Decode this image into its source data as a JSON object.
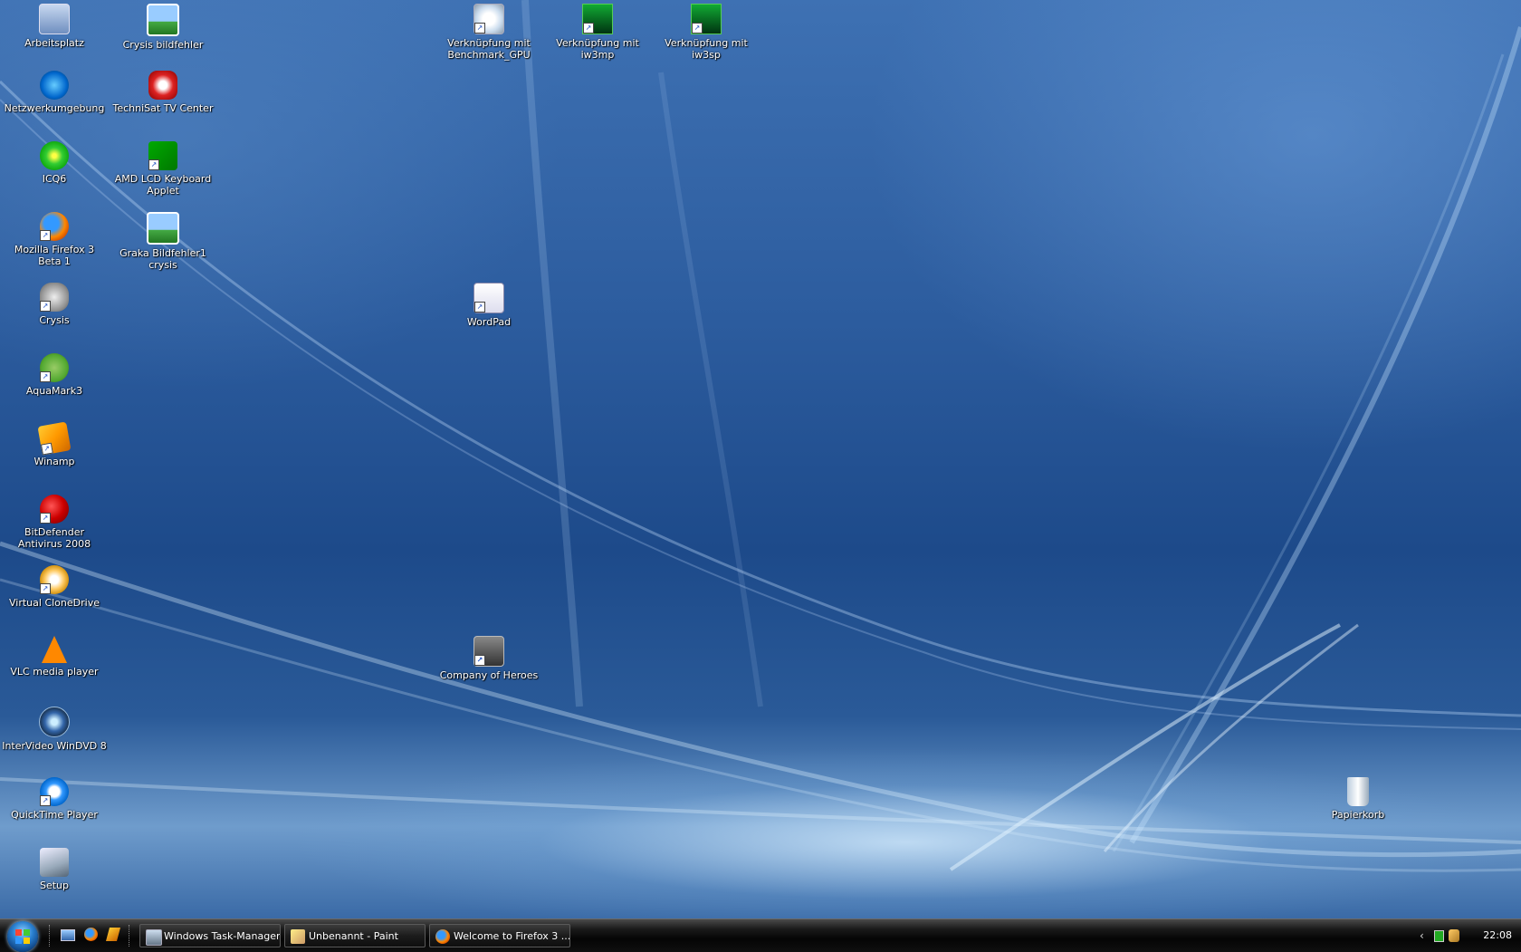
{
  "desktop": {
    "icons": [
      {
        "label": "Arbeitsplatz",
        "icon": "my-computer-icon"
      },
      {
        "label": "Crysis bildfehler",
        "icon": "image-file-icon"
      },
      {
        "label": "Verknüpfung mit Benchmark_GPU",
        "icon": "benchmark-shortcut-icon"
      },
      {
        "label": "Verknüpfung mit iw3mp",
        "icon": "cod4-shortcut-icon"
      },
      {
        "label": "Verknüpfung mit iw3sp",
        "icon": "cod4-shortcut-icon"
      },
      {
        "label": "Netzwerkumgebung",
        "icon": "network-icon"
      },
      {
        "label": "TechniSat TV Center",
        "icon": "technisat-icon"
      },
      {
        "label": "ICQ6",
        "icon": "icq-flower-icon"
      },
      {
        "label": "AMD LCD Keyboard Applet",
        "icon": "amd-logo-icon"
      },
      {
        "label": "Mozilla Firefox 3 Beta 1",
        "icon": "firefox-icon"
      },
      {
        "label": "Graka Bildfehler1 crysis",
        "icon": "image-file-icon"
      },
      {
        "label": "Crysis",
        "icon": "crysis-icon"
      },
      {
        "label": "WordPad",
        "icon": "wordpad-icon"
      },
      {
        "label": "AquaMark3",
        "icon": "aquamark-icon"
      },
      {
        "label": "Winamp",
        "icon": "winamp-icon"
      },
      {
        "label": "BitDefender Antivirus 2008",
        "icon": "bitdefender-icon"
      },
      {
        "label": "Virtual CloneDrive",
        "icon": "clonedrive-sheep-icon"
      },
      {
        "label": "VLC media player",
        "icon": "vlc-cone-icon"
      },
      {
        "label": "Company of Heroes",
        "icon": "coh-icon"
      },
      {
        "label": "InterVideo WinDVD 8",
        "icon": "windvd-icon"
      },
      {
        "label": "QuickTime Player",
        "icon": "quicktime-icon"
      },
      {
        "label": "Papierkorb",
        "icon": "recycle-bin-icon"
      },
      {
        "label": "Setup",
        "icon": "setup-icon"
      }
    ]
  },
  "taskbar": {
    "quick_launch": [
      "show-desktop-icon",
      "firefox-icon",
      "winamp-icon"
    ],
    "tasks": [
      {
        "label": "Windows Task-Manager",
        "icon": "task-manager-icon"
      },
      {
        "label": "Unbenannt - Paint",
        "icon": "paint-icon"
      },
      {
        "label": "Welcome to Firefox 3 ...",
        "icon": "firefox-icon"
      }
    ],
    "tray": {
      "clock": "22:08",
      "icons": [
        "show-hidden-icons-chevron-icon",
        "network-status-icon",
        "keyboard-icon"
      ]
    }
  },
  "colors": {
    "desktop_blue": "#2c5c9e",
    "taskbar_black": "#0f0f0f",
    "label_text": "#ffffff"
  }
}
